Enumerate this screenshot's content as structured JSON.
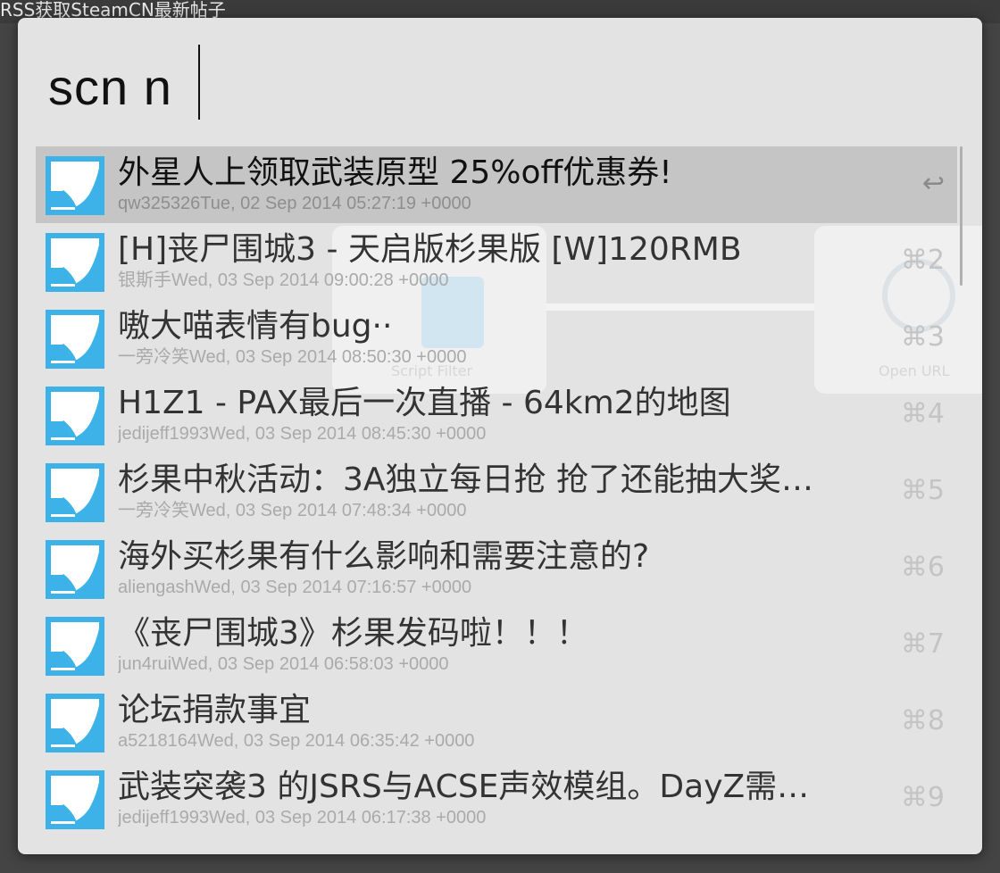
{
  "window": {
    "title": "RSS获取SteamCN最新帖子"
  },
  "search": {
    "query": "scn n"
  },
  "background": {
    "label_left": "Script Filter",
    "label_right": "Open URL"
  },
  "colors": {
    "panel": "#e3e3e3",
    "selected_row": "#c5c5c5",
    "icon_blue": "#3cb2e8"
  },
  "results": [
    {
      "title": "外星人上领取武装原型 25%off优惠券!",
      "subtitle": "qw325326Tue, 02 Sep 2014 05:27:19 +0000",
      "shortcut": "↩",
      "selected": true,
      "icon": "rss-item-icon"
    },
    {
      "title": "[H]丧尸围城3 - 天启版杉果版 [W]120RMB",
      "subtitle": "银斯手Wed, 03 Sep 2014 09:00:28 +0000",
      "shortcut": "⌘2",
      "icon": "rss-item-icon"
    },
    {
      "title": "嗷大喵表情有bug··",
      "subtitle": "一旁冷笑Wed, 03 Sep 2014 08:50:30 +0000",
      "shortcut": "⌘3",
      "icon": "rss-item-icon"
    },
    {
      "title": "H1Z1 - PAX最后一次直播 - 64km2的地图",
      "subtitle": "jedijeff1993Wed, 03 Sep 2014 08:45:30 +0000",
      "shortcut": "⌘4",
      "icon": "rss-item-icon"
    },
    {
      "title": "杉果中秋活动：3A独立每日抢 抢了还能抽大奖…",
      "subtitle": "一旁冷笑Wed, 03 Sep 2014 07:48:34 +0000",
      "shortcut": "⌘5",
      "icon": "rss-item-icon"
    },
    {
      "title": "海外买杉果有什么影响和需要注意的?",
      "subtitle": "aliengashWed, 03 Sep 2014 07:16:57 +0000",
      "shortcut": "⌘6",
      "icon": "rss-item-icon"
    },
    {
      "title": "《丧尸围城3》杉果发码啦！！！",
      "subtitle": "jun4ruiWed, 03 Sep 2014 06:58:03 +0000",
      "shortcut": "⌘7",
      "icon": "rss-item-icon"
    },
    {
      "title": "论坛捐款事宜",
      "subtitle": "a5218164Wed, 03 Sep 2014 06:35:42 +0000",
      "shortcut": "⌘8",
      "icon": "rss-item-icon"
    },
    {
      "title": "武装突袭3 的JSRS与ACSE声效模组。DayZ需…",
      "subtitle": "jedijeff1993Wed, 03 Sep 2014 06:17:38 +0000",
      "shortcut": "⌘9",
      "icon": "rss-item-icon"
    }
  ]
}
